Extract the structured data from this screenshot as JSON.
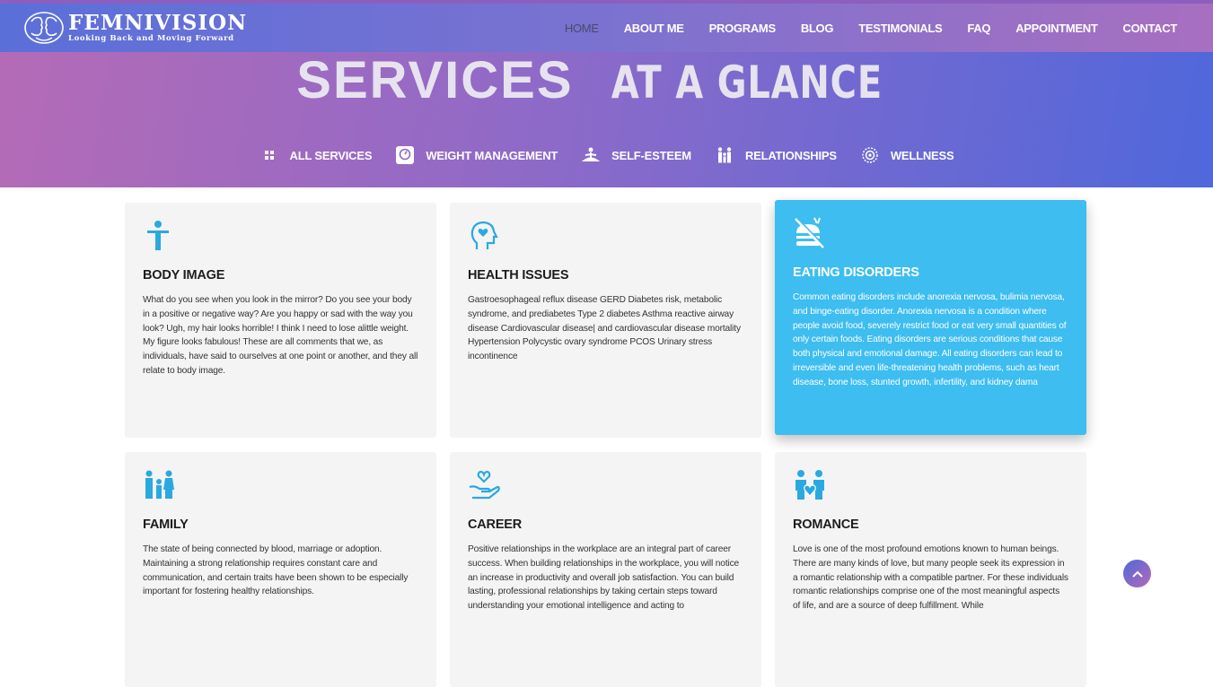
{
  "brand": {
    "name": "FEMNIVISION",
    "tagline": "Looking Back and Moving Forward"
  },
  "nav": [
    {
      "label": "HOME",
      "active": true
    },
    {
      "label": "ABOUT ME"
    },
    {
      "label": "PROGRAMS"
    },
    {
      "label": "BLOG"
    },
    {
      "label": "TESTIMONIALS"
    },
    {
      "label": "FAQ"
    },
    {
      "label": "APPOINTMENT"
    },
    {
      "label": "CONTACT"
    }
  ],
  "hero": {
    "title_bold": "SERVICES",
    "title_rest": "AT A GLANCE"
  },
  "filters": [
    {
      "label": "ALL SERVICES",
      "icon": "grid-icon"
    },
    {
      "label": "WEIGHT MANAGEMENT",
      "icon": "scale-icon"
    },
    {
      "label": "SELF-ESTEEM",
      "icon": "meditation-icon"
    },
    {
      "label": "RELATIONSHIPS",
      "icon": "family-icon"
    },
    {
      "label": "WELLNESS",
      "icon": "wellness-icon"
    }
  ],
  "cards": [
    {
      "title": "BODY IMAGE",
      "icon": "person-icon",
      "text": "What do you see when you look in the mirror? Do you see your body in a positive or negative way? Are you happy or sad with the way you look? Ugh, my hair looks horrible! I think I need to lose alittle weight. My figure looks fabulous! These are all comments that we, as individuals, have said to ourselves at one point or another, and they all relate to body image."
    },
    {
      "title": "HEALTH ISSUES",
      "icon": "head-heart-icon",
      "text": "Gastroesophageal reflux disease GERD Diabetes risk, metabolic syndrome, and prediabetes Type 2 diabetes Asthma reactive airway disease Cardiovascular disease| and cardiovascular disease mortality Hypertension Polycystic ovary syndrome PCOS Urinary stress incontinence"
    },
    {
      "title": "EATING DISORDERS",
      "icon": "no-food-icon",
      "featured": true,
      "text": "Common eating disorders include anorexia nervosa, bulimia nervosa, and binge-eating disorder. Anorexia nervosa is a condition where people avoid food, severely restrict food or eat very small quantities of only certain foods. Eating disorders are serious conditions that cause both physical and emotional damage. All eating disorders can lead to irreversible and even life-threatening health problems, such as heart disease, bone loss, stunted growth, infertility, and kidney dama"
    },
    {
      "title": "FAMILY",
      "icon": "family-icon",
      "text": "The state of being connected by blood, marriage or adoption. Maintaining a strong relationship requires constant care and communication, and certain traits have been shown to be especially important for fostering healthy relationships."
    },
    {
      "title": "CAREER",
      "icon": "hand-heart-icon",
      "text": "Positive relationships in the workplace are an integral part of career success. When building relationships in the workplace, you will notice an increase in productivity and overall job satisfaction. You can build lasting, professional relationships by taking certain steps toward understanding your emotional intelligence and acting to"
    },
    {
      "title": "ROMANCE",
      "icon": "couple-icon",
      "text": "Love is one of the most profound emotions known to human beings. There are many kinds of love, but many people seek its expression in a romantic relationship with a compatible partner. For these individuals romantic relationships comprise one of the most meaningful aspects of life, and are a source of deep fulfillment. While"
    }
  ],
  "colors": {
    "accent": "#3dbdf0",
    "icon": "#2aa9e0",
    "card_bg": "#f4f4f4"
  }
}
